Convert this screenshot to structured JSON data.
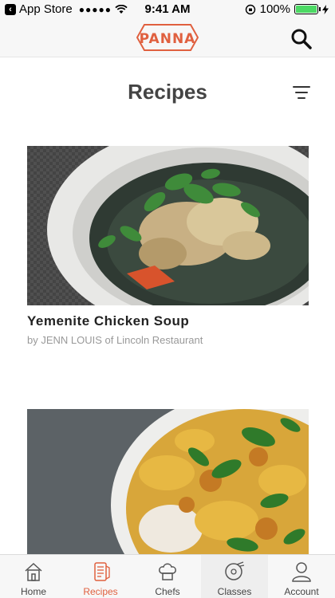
{
  "status_bar": {
    "back_app": "App Store",
    "signal_dots": "●●●●●",
    "time": "9:41 AM",
    "battery_percent": "100%",
    "battery_level": 1.0
  },
  "header": {
    "logo_text": "PANNA"
  },
  "page": {
    "title": "Recipes"
  },
  "recipes": [
    {
      "title": "Yemenite Chicken Soup",
      "byline": "by JENN LOUIS of Lincoln Restaurant"
    },
    {
      "title": "",
      "byline": ""
    }
  ],
  "tabs": [
    {
      "label": "Home",
      "icon": "home-icon"
    },
    {
      "label": "Recipes",
      "icon": "recipes-icon",
      "selected": true
    },
    {
      "label": "Chefs",
      "icon": "chef-hat-icon"
    },
    {
      "label": "Classes",
      "icon": "classes-icon"
    },
    {
      "label": "Account",
      "icon": "account-icon"
    }
  ],
  "colors": {
    "accent": "#e0603f",
    "battery": "#4cd964"
  }
}
